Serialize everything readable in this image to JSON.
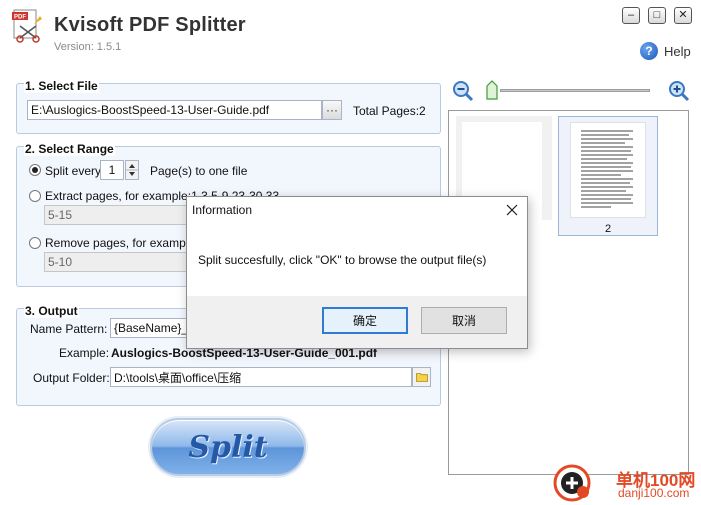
{
  "app": {
    "title": "Kvisoft PDF Splitter",
    "version": "Version: 1.5.1",
    "help_label": "Help",
    "logo_text": "PDF"
  },
  "window_controls": {
    "minimize": "–",
    "maximize": "□",
    "close": "✕"
  },
  "select_file": {
    "title": "1. Select File",
    "file_path": "E:\\Auslogics-BoostSpeed-13-User-Guide.pdf",
    "browse_label": "···",
    "total_pages": "Total Pages:2"
  },
  "select_range": {
    "title": "2. Select Range",
    "split_every_label": "Split every",
    "split_every_value": "1",
    "split_every_suffix": "Page(s) to one file",
    "extract_label": "Extract pages,  for example:1,3,5-9,23-30,33",
    "extract_value": "5-15",
    "remove_label": "Remove pages,  for example:",
    "remove_value": "5-10",
    "selected_mode": "split-every"
  },
  "output": {
    "title": "3. Output",
    "name_pattern_label": "Name Pattern:",
    "name_pattern_value": "{BaseName}_{0",
    "example_label": "Example:",
    "example_value": "Auslogics-BoostSpeed-13-User-Guide_001.pdf",
    "folder_label": "Output Folder:",
    "folder_value": "D:\\tools\\桌面\\office\\压缩"
  },
  "split_button_label": "Split",
  "preview": {
    "selected_page_label": "2"
  },
  "dialog": {
    "title": "Information",
    "message": "Split succesfully, click \"OK\" to browse the output file(s)",
    "ok_label": "确定",
    "cancel_label": "取消"
  },
  "watermark": {
    "site_cn": "单机100网",
    "site_url": "danji100.com"
  },
  "colors": {
    "panel_bg": "#f2f6fd",
    "panel_border": "#b9cbe3",
    "split_button": "#7fb1ea",
    "watermark": "#e24a25",
    "dialog_ok_border": "#2f7bd6"
  }
}
